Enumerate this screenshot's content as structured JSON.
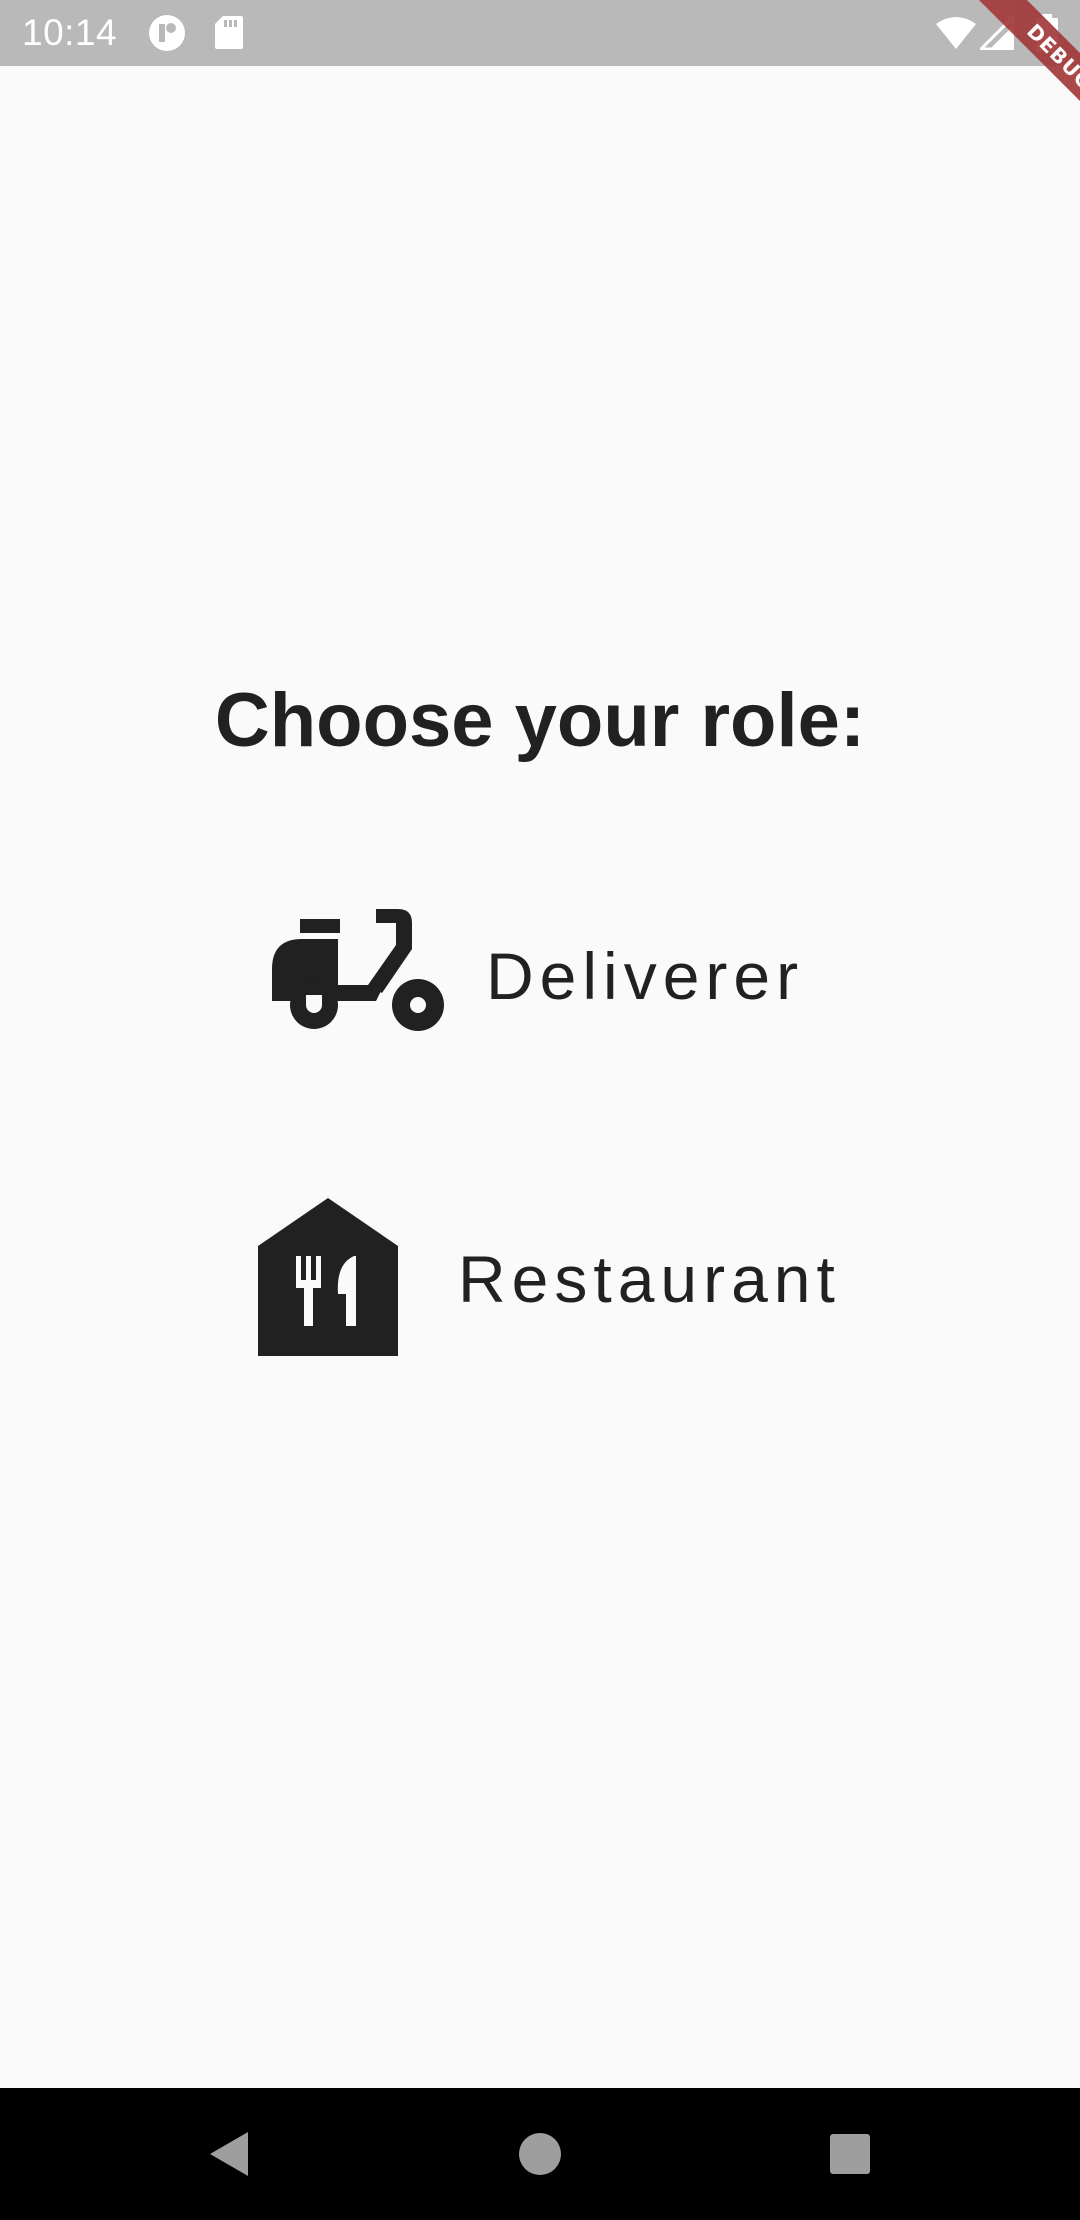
{
  "status_bar": {
    "time": "10:14",
    "icons": [
      "app-notification-icon",
      "sd-card-icon",
      "wifi-icon",
      "signal-icon",
      "battery-icon"
    ]
  },
  "debug_banner": {
    "label": "DEBUG",
    "color": "#a33a3a"
  },
  "page": {
    "title": "Choose your role:"
  },
  "roles": [
    {
      "label": "Deliverer",
      "icon": "scooter-icon"
    },
    {
      "label": "Restaurant",
      "icon": "restaurant-icon"
    }
  ],
  "nav_bar": {
    "buttons": [
      "back-icon",
      "home-icon",
      "recents-icon"
    ]
  },
  "colors": {
    "status_bar": "#b9b9b9",
    "background": "#fafafa",
    "text": "#212121",
    "nav_bar": "#000000"
  }
}
